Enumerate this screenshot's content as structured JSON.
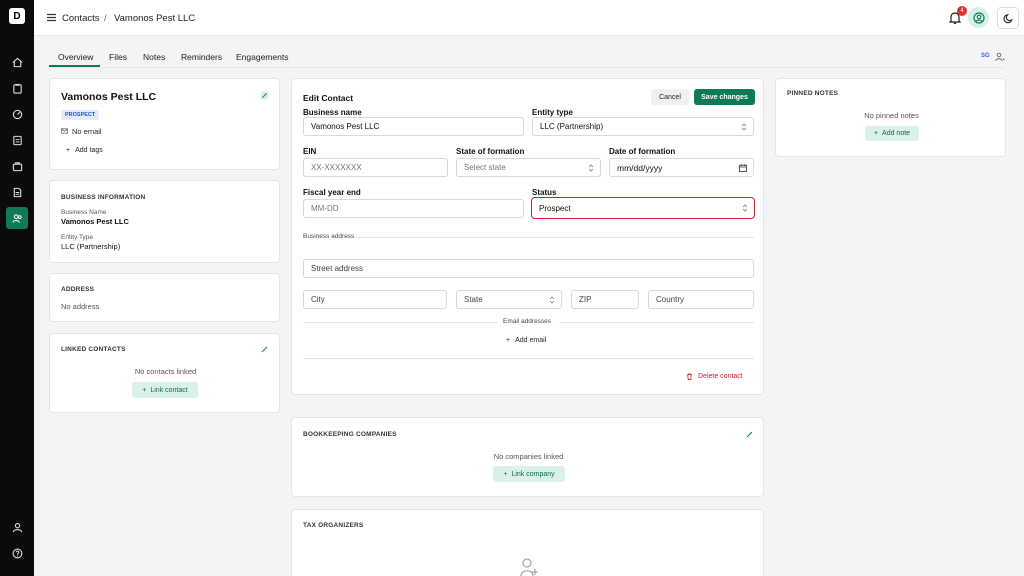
{
  "app": {
    "logo_letter": "D"
  },
  "breadcrumb": {
    "root": "Contacts",
    "separator": "/",
    "current": "Vamonos Pest LLC"
  },
  "notifications": {
    "count": "4"
  },
  "tabs": [
    "Overview",
    "Files",
    "Notes",
    "Reminders",
    "Engagements"
  ],
  "assignee": {
    "initials": "SG"
  },
  "contact_card": {
    "name": "Vamonos Pest LLC",
    "status_badge": "PROSPECT",
    "email": "No email",
    "add_tags": "Add tags"
  },
  "business_info": {
    "title": "BUSINESS INFORMATION",
    "name_label": "Business Name",
    "name_value": "Vamonos Pest LLC",
    "type_label": "Entity Type",
    "type_value": "LLC (Partnership)"
  },
  "address": {
    "title": "ADDRESS",
    "value": "No address"
  },
  "linked_contacts": {
    "title": "LINKED CONTACTS",
    "empty": "No contacts linked",
    "button": "Link contact"
  },
  "edit_form": {
    "title": "Edit Contact",
    "cancel": "Cancel",
    "save": "Save changes",
    "business_name_label": "Business name",
    "business_name_value": "Vamonos Pest LLC",
    "entity_type_label": "Entity type",
    "entity_type_value": "LLC (Partnership)",
    "ein_label": "EIN",
    "ein_placeholder": "XX-XXXXXXX",
    "state_formation_label": "State of formation",
    "state_formation_placeholder": "Select state",
    "date_formation_label": "Date of formation",
    "date_formation_placeholder": "mm/dd/yyyy",
    "fiscal_label": "Fiscal year end",
    "fiscal_placeholder": "MM-DD",
    "status_label": "Status",
    "status_value": "Prospect",
    "business_address_label": "Business address",
    "street_placeholder": "Street address",
    "city_placeholder": "City",
    "state_placeholder": "State",
    "zip_placeholder": "ZIP",
    "country_placeholder": "Country",
    "email_addresses_label": "Email addresses",
    "add_email": "Add email",
    "delete": "Delete contact"
  },
  "bookkeeping": {
    "title": "BOOKKEEPING COMPANIES",
    "empty": "No companies linked",
    "button": "Link company"
  },
  "tax_organizers": {
    "title": "TAX ORGANIZERS"
  },
  "pinned_notes": {
    "title": "PINNED NOTES",
    "empty": "No pinned notes",
    "button": "Add note"
  },
  "colors": {
    "accent": "#0f7a55",
    "highlight": "#d81e2a",
    "badge": "#e0342b"
  }
}
